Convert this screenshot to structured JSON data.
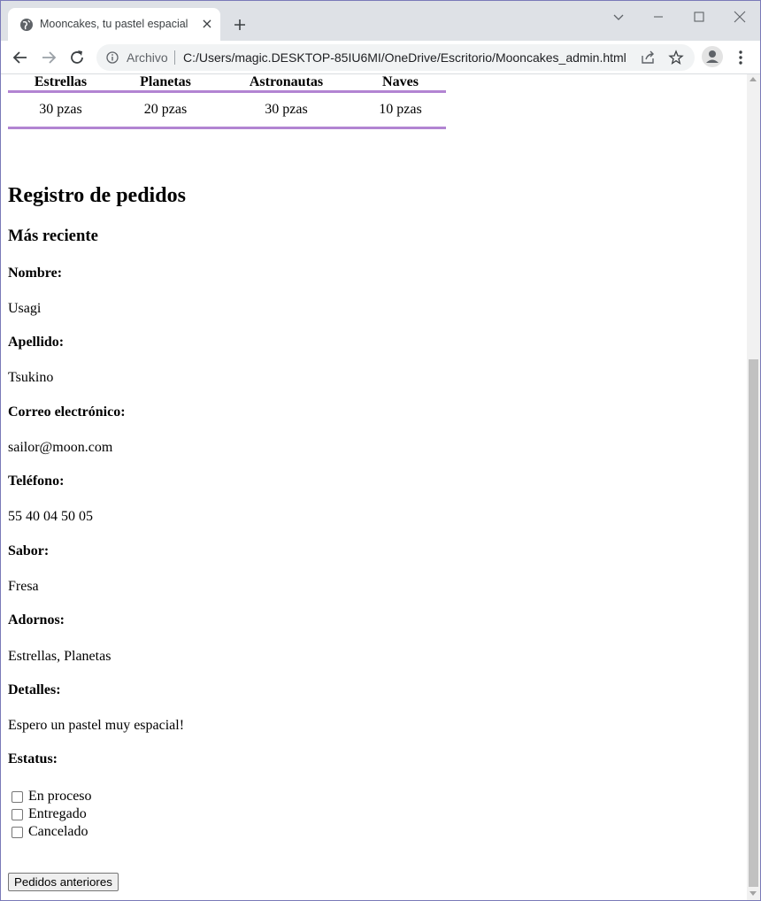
{
  "browser": {
    "tab_title": "Mooncakes, tu pastel espacial",
    "tab_close": "×",
    "omnibox_scheme_label": "Archivo",
    "url": "C:/Users/magic.DESKTOP-85IU6MI/OneDrive/Escritorio/Mooncakes_admin.html"
  },
  "inventory": {
    "headers": [
      "Estrellas",
      "Planetas",
      "Astronautas",
      "Naves"
    ],
    "values": [
      "30 pzas",
      "20 pzas",
      "30 pzas",
      "10 pzas"
    ],
    "line_color": "#b284d2"
  },
  "orders": {
    "title": "Registro de pedidos",
    "subtitle": "Más reciente",
    "fields": [
      {
        "label": "Nombre:",
        "value": "Usagi"
      },
      {
        "label": "Apellido:",
        "value": "Tsukino"
      },
      {
        "label": "Correo electrónico:",
        "value": "sailor@moon.com"
      },
      {
        "label": "Teléfono:",
        "value": "55 40 04 50 05"
      },
      {
        "label": "Sabor:",
        "value": "Fresa"
      },
      {
        "label": "Adornos:",
        "value": "Estrellas, Planetas"
      },
      {
        "label": "Detalles:",
        "value": "Espero un pastel muy espacial!"
      }
    ],
    "status_label": "Estatus:",
    "status_options": [
      "En proceso",
      "Entregado",
      "Cancelado"
    ],
    "previous_button": "Pedidos anteriores"
  }
}
